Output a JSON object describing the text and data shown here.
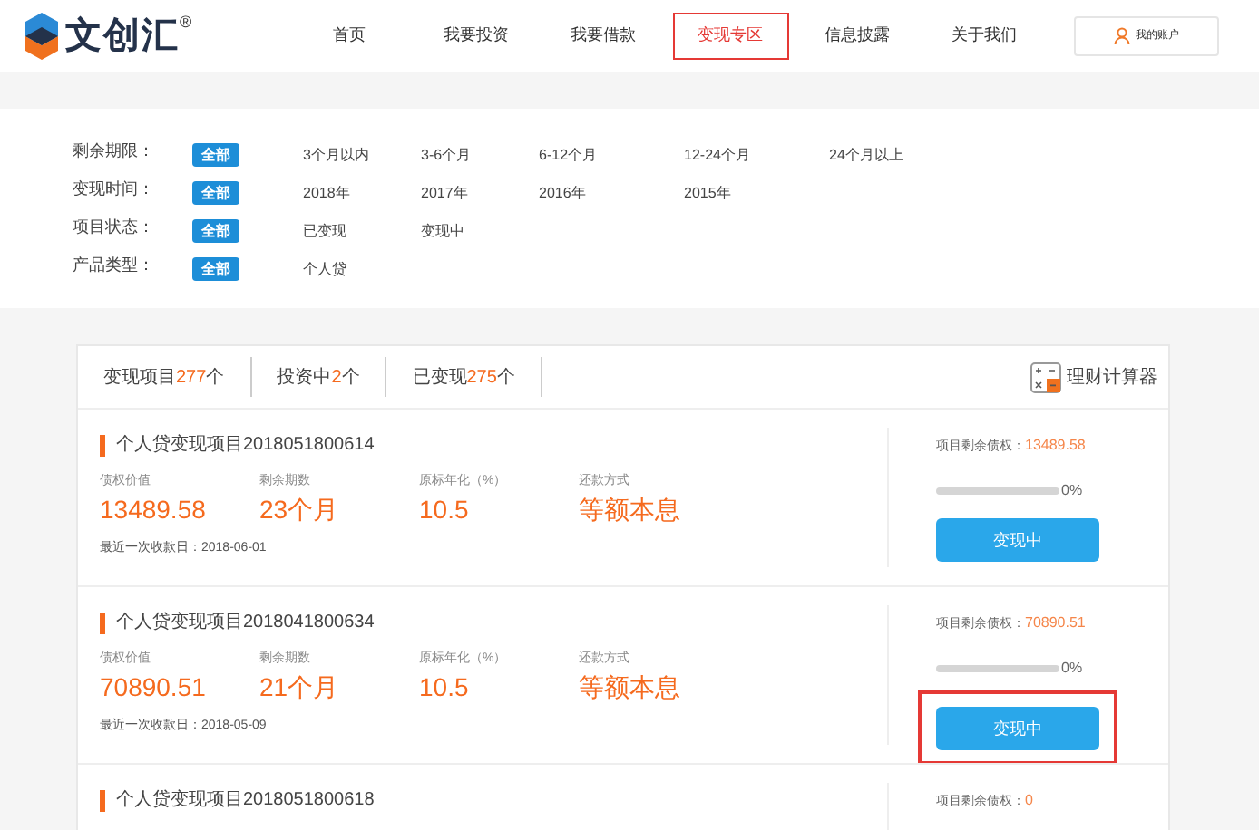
{
  "logo": {
    "text": "文创汇",
    "mark": "®"
  },
  "nav": [
    {
      "label": "首页",
      "selected": false
    },
    {
      "label": "我要投资",
      "selected": false
    },
    {
      "label": "我要借款",
      "selected": false
    },
    {
      "label": "变现专区",
      "selected": true
    },
    {
      "label": "信息披露",
      "selected": false
    },
    {
      "label": "关于我们",
      "selected": false
    }
  ],
  "account_button": "我的账户",
  "filters": [
    {
      "label": "剩余期限：",
      "options": [
        {
          "label": "全部",
          "selected": true
        },
        {
          "label": "3个月以内",
          "selected": false
        },
        {
          "label": "3-6个月",
          "selected": false
        },
        {
          "label": "6-12个月",
          "selected": false
        },
        {
          "label": "12-24个月",
          "selected": false
        },
        {
          "label": "24个月以上",
          "selected": false
        }
      ]
    },
    {
      "label": "变现时间：",
      "options": [
        {
          "label": "全部",
          "selected": true
        },
        {
          "label": "2018年",
          "selected": false
        },
        {
          "label": "2017年",
          "selected": false
        },
        {
          "label": "2016年",
          "selected": false
        },
        {
          "label": "2015年",
          "selected": false
        }
      ]
    },
    {
      "label": "项目状态：",
      "options": [
        {
          "label": "全部",
          "selected": true
        },
        {
          "label": "已变现",
          "selected": false
        },
        {
          "label": "变现中",
          "selected": false
        }
      ]
    },
    {
      "label": "产品类型：",
      "options": [
        {
          "label": "全部",
          "selected": true
        },
        {
          "label": "个人贷",
          "selected": false
        }
      ]
    }
  ],
  "tabs": [
    {
      "label": "变现项目",
      "count": "277",
      "unit": "个"
    },
    {
      "label": "投资中",
      "count": "2",
      "unit": "个"
    },
    {
      "label": "已变现",
      "count": "275",
      "unit": "个"
    }
  ],
  "calculator": "理财计算器",
  "items": [
    {
      "title": "个人贷变现项目2018051800614",
      "stats": [
        {
          "label": "债权价值",
          "value": "13489.58"
        },
        {
          "label": "剩余期数",
          "value": "23个月"
        },
        {
          "label": "原标年化（%）",
          "value": "10.5"
        },
        {
          "label": "还款方式",
          "value": "等额本息"
        }
      ],
      "last_date": "最近一次收款日：2018-06-01",
      "remaining_label": "项目剩余债权：",
      "remaining": "13489.58",
      "level": 0,
      "percent": "0%",
      "button": "变现中",
      "highlighted": false
    },
    {
      "title": "个人贷变现项目2018041800634",
      "stats": [
        {
          "label": "债权价值",
          "value": "70890.51"
        },
        {
          "label": "剩余期数",
          "value": "21个月"
        },
        {
          "label": "原标年化（%）",
          "value": "10.5"
        },
        {
          "label": "还款方式",
          "value": "等额本息"
        }
      ],
      "last_date": "最近一次收款日：2018-05-09",
      "remaining_label": "项目剩余债权：",
      "remaining": "70890.51",
      "level": 0,
      "percent": "0%",
      "button": "变现中",
      "highlighted": true
    },
    {
      "title": "个人贷变现项目2018051800618",
      "remaining_label": "项目剩余债权：",
      "remaining": "0"
    }
  ]
}
